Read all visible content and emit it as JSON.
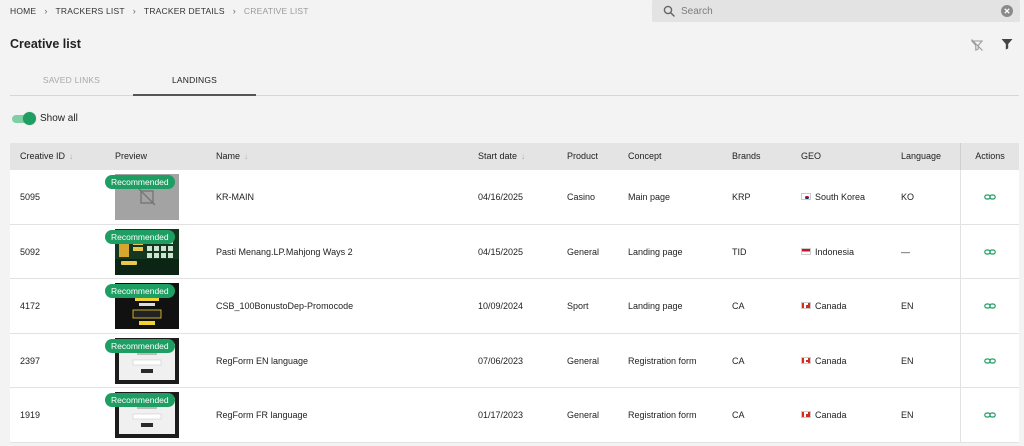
{
  "breadcrumb": {
    "items": [
      "HOME",
      "TRACKERS LIST",
      "TRACKER DETAILS",
      "CREATIVE LIST"
    ]
  },
  "search": {
    "placeholder": "Search",
    "value": ""
  },
  "page": {
    "title": "Creative list"
  },
  "tabs": [
    {
      "label": "SAVED LINKS",
      "active": false
    },
    {
      "label": "LANDINGS",
      "active": true
    }
  ],
  "toggle": {
    "label": "Show all",
    "on": true
  },
  "table": {
    "columns": {
      "creative_id": "Creative ID",
      "preview": "Preview",
      "name": "Name",
      "start_date": "Start date",
      "product": "Product",
      "concept": "Concept",
      "brands": "Brands",
      "geo": "GEO",
      "language": "Language",
      "actions": "Actions"
    },
    "badge": "Recommended",
    "rows": [
      {
        "id": "5095",
        "name": "KR-MAIN",
        "start_date": "04/16/2025",
        "product": "Casino",
        "concept": "Main page",
        "brand": "KRP",
        "geo": "South Korea",
        "flag": "kr",
        "language": "KO"
      },
      {
        "id": "5092",
        "name": "Pasti Menang.LP.Mahjong Ways 2",
        "start_date": "04/15/2025",
        "product": "General",
        "concept": "Landing page",
        "brand": "TID",
        "geo": "Indonesia",
        "flag": "id",
        "language": "—"
      },
      {
        "id": "4172",
        "name": "CSB_100BonustoDep-Promocode",
        "start_date": "10/09/2024",
        "product": "Sport",
        "concept": "Landing page",
        "brand": "CA",
        "geo": "Canada",
        "flag": "ca",
        "language": "EN"
      },
      {
        "id": "2397",
        "name": "RegForm EN language",
        "start_date": "07/06/2023",
        "product": "General",
        "concept": "Registration form",
        "brand": "CA",
        "geo": "Canada",
        "flag": "ca",
        "language": "EN"
      },
      {
        "id": "1919",
        "name": "RegForm FR language",
        "start_date": "01/17/2023",
        "product": "General",
        "concept": "Registration form",
        "brand": "CA",
        "geo": "Canada",
        "flag": "ca",
        "language": "EN"
      }
    ]
  },
  "colors": {
    "accent": "#1f9e63",
    "header_bg": "#e4e4e4",
    "page_bg": "#f3f3f3"
  },
  "icons": {
    "search": "search-icon",
    "clear": "clear-icon",
    "filter_off": "filter-off-icon",
    "filter": "filter-icon",
    "link": "link-icon",
    "sort": "sort-icon"
  }
}
